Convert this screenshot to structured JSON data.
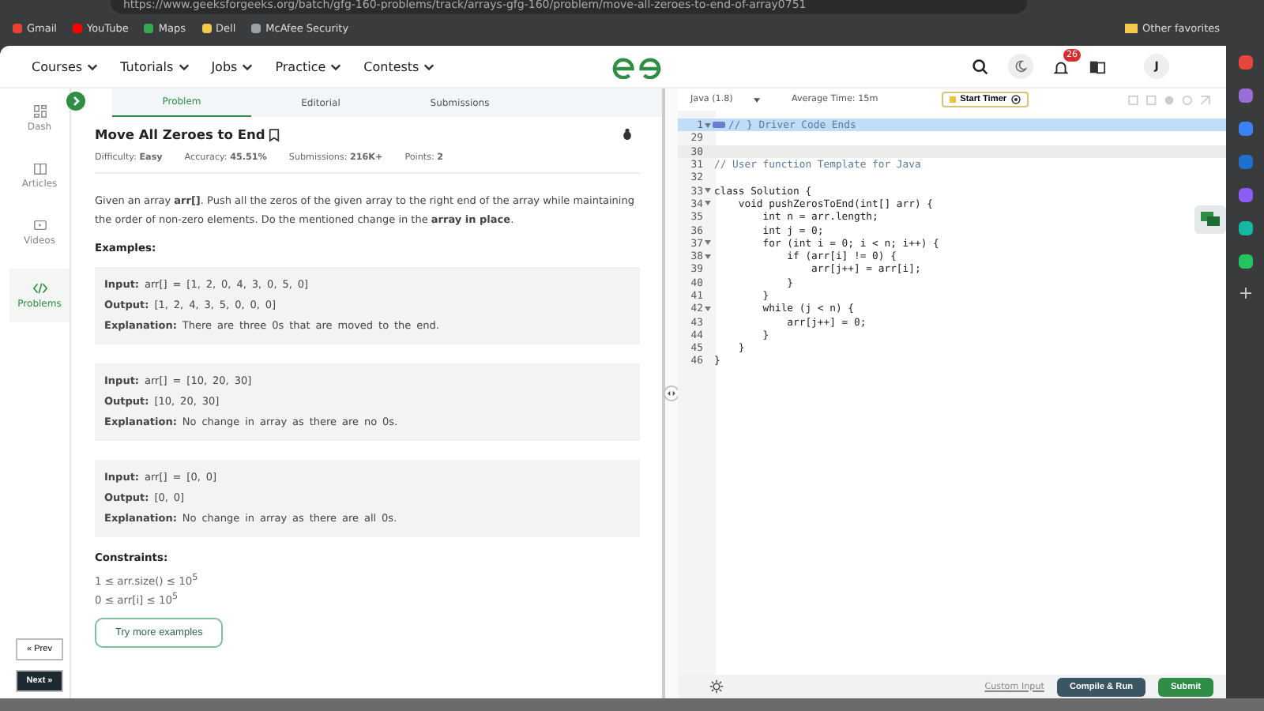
{
  "browser": {
    "url": "https://www.geeksforgeeks.org/batch/gfg-160-problems/track/arrays-gfg-160/problem/move-all-zeroes-to-end-of-array0751",
    "bookmarks": [
      {
        "label": "Gmail",
        "color": "#ea4335"
      },
      {
        "label": "YouTube",
        "color": "#ff0000"
      },
      {
        "label": "Maps",
        "color": "#34a853"
      },
      {
        "label": "Dell",
        "color": "#f2c94c"
      },
      {
        "label": "McAfee Security",
        "color": "#9aa0a6"
      }
    ],
    "other_favorites": "Other favorites"
  },
  "nav": {
    "menus": [
      "Courses",
      "Tutorials",
      "Jobs",
      "Practice",
      "Contests"
    ],
    "notification_count": "26",
    "avatar": "J"
  },
  "rail": [
    {
      "label": "Dash",
      "selected": false
    },
    {
      "label": "Articles",
      "selected": false
    },
    {
      "label": "Videos",
      "selected": false
    },
    {
      "label": "Problems",
      "selected": true
    }
  ],
  "pager": {
    "prev": "« Prev",
    "next": "Next »"
  },
  "tabs": [
    {
      "label": "Problem",
      "selected": true
    },
    {
      "label": "Editorial",
      "selected": false
    },
    {
      "label": "Submissions",
      "selected": false
    }
  ],
  "problem": {
    "title": "Move All Zeroes to End",
    "stats": [
      "Difficulty: **Easy**",
      "Accuracy: **45.51%**",
      "Submissions: **216K+**",
      "Points: **2**"
    ],
    "description": "Given an array **arr[]**. Push all the zeros of the given array to the right end of the array while maintaining the order of non-zero elements. Do the mentioned change in the **array in place**.",
    "examples_heading": "Examples:",
    "examples": [
      {
        "input": "**Input:** arr[] = [1, 2, 0, 4, 3, 0, 5, 0]",
        "output": "**Output:** [1, 2, 4, 3, 5, 0, 0, 0]",
        "explanation": "**Explanation:** There are three 0s that are moved to the end."
      },
      {
        "input": "**Input:** arr[] = [10, 20, 30]",
        "output": "**Output:** [10, 20, 30]",
        "explanation": "**Explanation:** No change in array as there are no 0s."
      },
      {
        "input": "**Input:** arr[] = [0, 0]",
        "output": "**Output:** [0, 0]",
        "explanation": "**Explanation:** No change in array as there are all 0s."
      }
    ],
    "constraints_heading": "Constraints:",
    "constraints": [
      "1 ≤ arr.size() ≤ 10$^{5}$",
      "0 ≤ arr[i] ≤ 10$^{5}$"
    ],
    "try_button": "Try more examples"
  },
  "editor": {
    "language": "Java (1.8)",
    "average_time": "Average Time: 15m",
    "timer_button": "Start Timer",
    "lines": [
      {
        "number": "1",
        "text": "// } Driver Code Ends",
        "kind": "comment",
        "fold": true,
        "selected": true,
        "current": false
      },
      {
        "number": "29",
        "fold": false,
        "selected": false,
        "current": false
      },
      {
        "number": "30",
        "fold": false,
        "selected": false,
        "current": true
      },
      {
        "number": "31",
        "text": "// User function Template for Java",
        "kind": "comment",
        "fold": false,
        "selected": false,
        "current": false
      },
      {
        "number": "32",
        "fold": false,
        "selected": false,
        "current": false
      },
      {
        "number": "33",
        "text": "class Solution {",
        "kind": "code",
        "fold": true,
        "selected": false,
        "current": false
      },
      {
        "number": "34",
        "text": "    void pushZerosToEnd(int[] arr) {",
        "kind": "code",
        "fold": true,
        "selected": false,
        "current": false
      },
      {
        "number": "35",
        "text": "        int n = arr.length;",
        "kind": "code",
        "fold": false,
        "selected": false,
        "current": false
      },
      {
        "number": "36",
        "text": "        int j = 0;",
        "kind": "code",
        "fold": false,
        "selected": false,
        "current": false
      },
      {
        "number": "37",
        "text": "        for (int i = 0; i < n; i++) {",
        "kind": "code",
        "fold": true,
        "selected": false,
        "current": false
      },
      {
        "number": "38",
        "text": "            if (arr[i] != 0) {",
        "kind": "code",
        "fold": true,
        "selected": false,
        "current": false
      },
      {
        "number": "39",
        "text": "                arr[j++] = arr[i];",
        "kind": "code",
        "fold": false,
        "selected": false,
        "current": false
      },
      {
        "number": "40",
        "text": "            }",
        "kind": "code",
        "fold": false,
        "selected": false,
        "current": false
      },
      {
        "number": "41",
        "text": "        }",
        "kind": "code",
        "fold": false,
        "selected": false,
        "current": false
      },
      {
        "number": "42",
        "text": "        while (j < n) {",
        "kind": "code",
        "fold": true,
        "selected": false,
        "current": false
      },
      {
        "number": "43",
        "text": "            arr[j++] = 0;",
        "kind": "code",
        "fold": false,
        "selected": false,
        "current": false
      },
      {
        "number": "44",
        "text": "        }",
        "kind": "code",
        "fold": false,
        "selected": false,
        "current": false
      },
      {
        "number": "45",
        "text": "    }",
        "kind": "code",
        "fold": false,
        "selected": false,
        "current": false
      },
      {
        "number": "46",
        "text": "}",
        "kind": "code",
        "fold": false,
        "selected": false,
        "current": false
      }
    ],
    "custom_input": "Custom Input",
    "run_button": "Compile & Run",
    "submit_button": "Submit"
  }
}
